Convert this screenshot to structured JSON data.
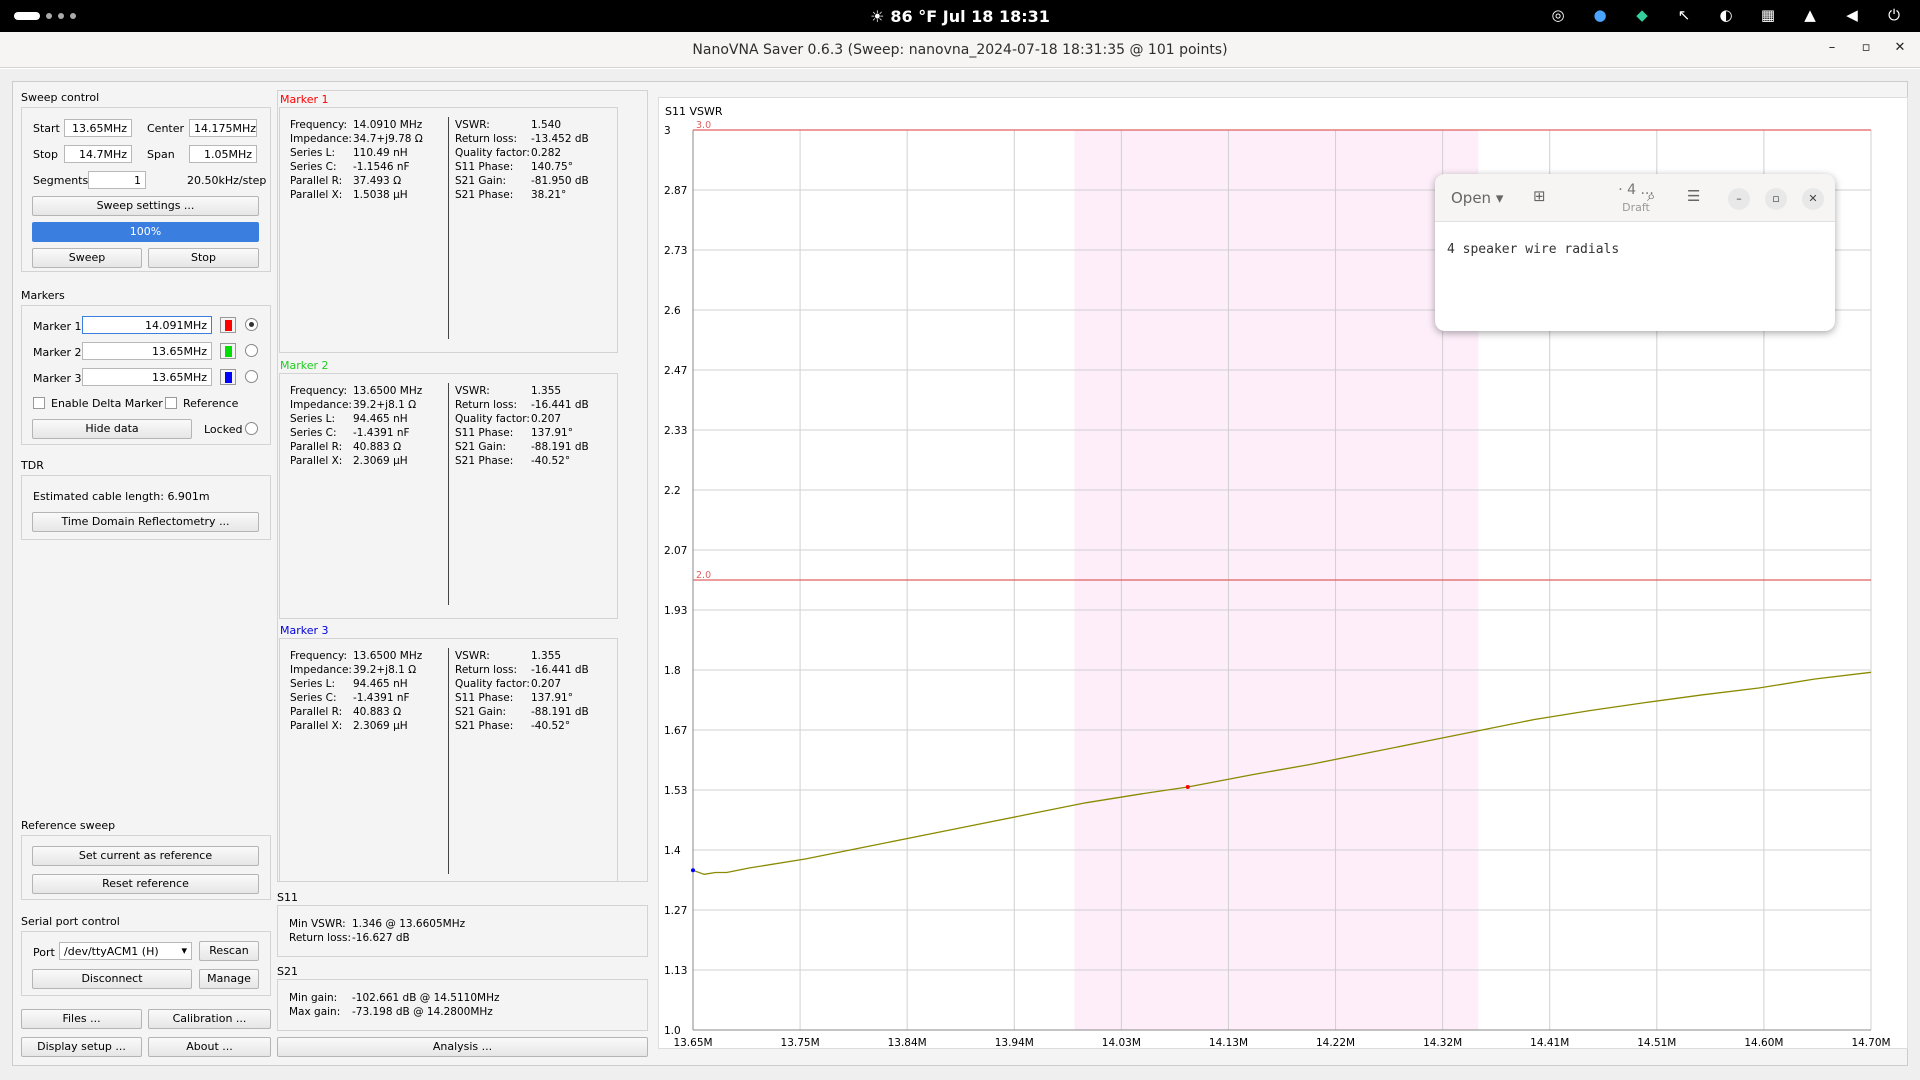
{
  "topbar": {
    "weather": "☀",
    "clock": "86 °F  Jul 18  18:31",
    "tray_icons": [
      "browser-icon",
      "zoom-icon",
      "sync-icon",
      "cursor-icon",
      "vpn-icon",
      "panel-icon",
      "wifi-icon",
      "volume-icon",
      "power-icon"
    ]
  },
  "window": {
    "title": "NanoVNA Saver 0.6.3 (Sweep: nanovna_2024-07-18 18:31:35 @ 101 points)",
    "minimize": "–",
    "maximize": "▫",
    "close": "✕"
  },
  "sweep": {
    "section": "Sweep control",
    "start_label": "Start",
    "start": "13.65MHz",
    "center_label": "Center",
    "center": "14.175MHz",
    "stop_label": "Stop",
    "stop": "14.7MHz",
    "span_label": "Span",
    "span": "1.05MHz",
    "segments_label": "Segments",
    "segments": "1",
    "step": "20.50kHz/step",
    "settings_button": "Sweep settings ...",
    "progress": "100%",
    "sweep_button": "Sweep",
    "stop_button": "Stop"
  },
  "markers": {
    "section": "Markers",
    "items": [
      {
        "label": "Marker 1",
        "value": "14.091MHz",
        "color": "#ff0000",
        "selected": true
      },
      {
        "label": "Marker 2",
        "value": "13.65MHz",
        "color": "#00dd00",
        "selected": false
      },
      {
        "label": "Marker 3",
        "value": "13.65MHz",
        "color": "#0000ff",
        "selected": false
      }
    ],
    "delta_label": "Enable Delta Marker",
    "reference_label": "Reference",
    "hide_button": "Hide data",
    "locked_label": "Locked"
  },
  "tdr": {
    "section": "TDR",
    "cable_label": "Estimated cable length:",
    "cable_value": "6.901m",
    "button": "Time Domain Reflectometry ..."
  },
  "reference_sweep": {
    "section": "Reference sweep",
    "set_button": "Set current as reference",
    "reset_button": "Reset reference"
  },
  "serial": {
    "section": "Serial port control",
    "port_label": "Port",
    "port": "/dev/ttyACM1 (H)",
    "rescan_button": "Rescan",
    "disconnect_button": "Disconnect",
    "manage_button": "Manage"
  },
  "bottom_buttons": {
    "files": "Files ...",
    "calibration": "Calibration ...",
    "display": "Display setup ...",
    "about": "About ...",
    "analysis": "Analysis ..."
  },
  "marker_panels": [
    {
      "title": "Marker 1",
      "title_color": "#ff0000",
      "left": [
        [
          "Frequency:",
          "14.0910 MHz"
        ],
        [
          "Impedance:",
          "34.7+j9.78 Ω"
        ],
        [
          "Series L:",
          "110.49 nH"
        ],
        [
          "Series C:",
          "-1.1546 nF"
        ],
        [
          "Parallel R:",
          "37.493 Ω"
        ],
        [
          "Parallel X:",
          "1.5038 µH"
        ]
      ],
      "right": [
        [
          "VSWR:",
          "1.540"
        ],
        [
          "Return loss:",
          "-13.452 dB"
        ],
        [
          "Quality factor:",
          "0.282"
        ],
        [
          "S11 Phase:",
          "140.75°"
        ],
        [
          "S21 Gain:",
          "-81.950 dB"
        ],
        [
          "S21 Phase:",
          "38.21°"
        ]
      ]
    },
    {
      "title": "Marker 2",
      "title_color": "#22cc22",
      "left": [
        [
          "Frequency:",
          "13.6500 MHz"
        ],
        [
          "Impedance:",
          "39.2+j8.1 Ω"
        ],
        [
          "Series L:",
          "94.465 nH"
        ],
        [
          "Series C:",
          "-1.4391 nF"
        ],
        [
          "Parallel R:",
          "40.883 Ω"
        ],
        [
          "Parallel X:",
          "2.3069 µH"
        ]
      ],
      "right": [
        [
          "VSWR:",
          "1.355"
        ],
        [
          "Return loss:",
          "-16.441 dB"
        ],
        [
          "Quality factor:",
          "0.207"
        ],
        [
          "S11 Phase:",
          "137.91°"
        ],
        [
          "S21 Gain:",
          "-88.191 dB"
        ],
        [
          "S21 Phase:",
          "-40.52°"
        ]
      ]
    },
    {
      "title": "Marker 3",
      "title_color": "#0000dd",
      "left": [
        [
          "Frequency:",
          "13.6500 MHz"
        ],
        [
          "Impedance:",
          "39.2+j8.1 Ω"
        ],
        [
          "Series L:",
          "94.465 nH"
        ],
        [
          "Series C:",
          "-1.4391 nF"
        ],
        [
          "Parallel R:",
          "40.883 Ω"
        ],
        [
          "Parallel X:",
          "2.3069 µH"
        ]
      ],
      "right": [
        [
          "VSWR:",
          "1.355"
        ],
        [
          "Return loss:",
          "-16.441 dB"
        ],
        [
          "Quality factor:",
          "0.207"
        ],
        [
          "S11 Phase:",
          "137.91°"
        ],
        [
          "S21 Gain:",
          "-88.191 dB"
        ],
        [
          "S21 Phase:",
          "-40.52°"
        ]
      ]
    }
  ],
  "s11": {
    "title": "S11",
    "min_vswr_label": "Min VSWR:",
    "min_vswr": "1.346 @ 13.6605MHz",
    "return_loss_label": "Return loss:",
    "return_loss": "-16.627 dB"
  },
  "s21": {
    "title": "S21",
    "min_gain_label": "Min gain:",
    "min_gain": "-102.661 dB @ 14.5110MHz",
    "max_gain_label": "Max gain:",
    "max_gain": "-73.198 dB @ 14.2800MHz"
  },
  "chart_data": {
    "type": "line",
    "title": "S11 VSWR",
    "ylim": [
      1.0,
      3.0
    ],
    "xlim": [
      13.65,
      14.7
    ],
    "y_ticks": [
      "3",
      "2.87",
      "2.73",
      "2.6",
      "2.47",
      "2.33",
      "2.2",
      "2.07",
      "1.93",
      "1.8",
      "1.67",
      "1.53",
      "1.4",
      "1.27",
      "1.13",
      "1.0"
    ],
    "x_ticks": [
      "13.65M",
      "13.75M",
      "13.84M",
      "13.94M",
      "14.03M",
      "14.13M",
      "14.22M",
      "14.32M",
      "14.41M",
      "14.51M",
      "14.60M",
      "14.70M"
    ],
    "reference_lines": [
      {
        "value": 3.0,
        "label": "3.0"
      },
      {
        "value": 2.0,
        "label": "2.0"
      }
    ],
    "band": [
      13.99,
      14.35
    ],
    "grid": true,
    "line_color": "#8a8a00",
    "band_color": "#fdeefa",
    "marker1": {
      "x": 14.091,
      "y": 1.54
    },
    "series": [
      {
        "x": [
          13.65,
          13.66,
          13.67,
          13.68,
          13.7,
          13.75,
          13.8,
          13.85,
          13.9,
          13.95,
          14.0,
          14.05,
          14.091,
          14.15,
          14.2,
          14.25,
          14.3,
          14.35,
          14.4,
          14.45,
          14.5,
          14.55,
          14.6,
          14.65,
          14.7
        ],
        "values": [
          1.355,
          1.346,
          1.35,
          1.35,
          1.36,
          1.38,
          1.405,
          1.43,
          1.455,
          1.48,
          1.505,
          1.525,
          1.54,
          1.568,
          1.59,
          1.615,
          1.64,
          1.665,
          1.69,
          1.71,
          1.728,
          1.745,
          1.76,
          1.78,
          1.795
        ]
      }
    ]
  },
  "editor": {
    "open_label": "Open",
    "title": "· 4 ...",
    "subtitle": "Draft",
    "content": "4 speaker wire radials"
  }
}
